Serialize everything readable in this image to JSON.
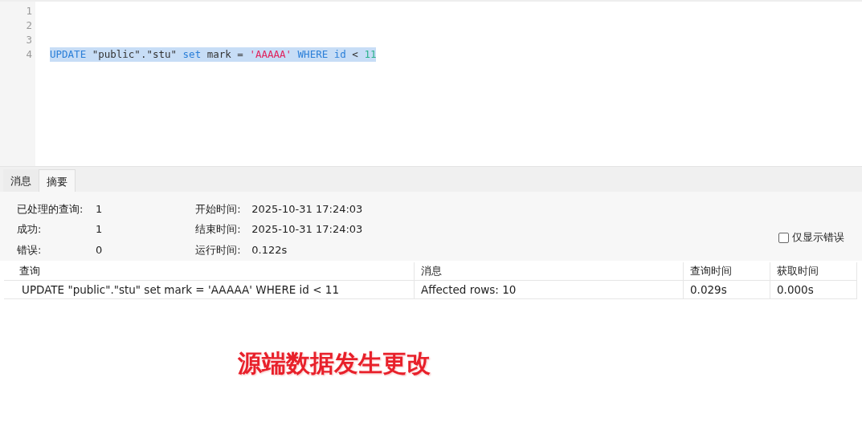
{
  "editor": {
    "lines": [
      {
        "number": "1"
      },
      {
        "number": "2"
      },
      {
        "number": "3"
      },
      {
        "number": "4",
        "selected": true,
        "tokens": [
          {
            "kind": "keyword",
            "text": "UPDATE"
          },
          {
            "kind": "plain",
            "text": " \"public\".\"stu\" "
          },
          {
            "kind": "keyword",
            "text": "set"
          },
          {
            "kind": "plain",
            "text": " mark = "
          },
          {
            "kind": "string",
            "text": "'AAAAA'"
          },
          {
            "kind": "keyword",
            "text": " WHERE id"
          },
          {
            "kind": "plain",
            "text": " < "
          },
          {
            "kind": "number",
            "text": "11"
          }
        ]
      }
    ]
  },
  "tabs": [
    {
      "label": "消息",
      "selected": false
    },
    {
      "label": "摘要",
      "selected": true
    }
  ],
  "summary": {
    "left": [
      {
        "label": "已处理的查询:",
        "value": "1"
      },
      {
        "label": "成功:",
        "value": "1"
      },
      {
        "label": "错误:",
        "value": "0"
      }
    ],
    "right": [
      {
        "label": "开始时间:",
        "value": "2025-10-31 17:24:03"
      },
      {
        "label": "结束时间:",
        "value": "2025-10-31 17:24:03"
      },
      {
        "label": "运行时间:",
        "value": "0.122s"
      }
    ],
    "errors_only": {
      "label": "仅显示错误",
      "checked": false
    }
  },
  "table": {
    "columns": [
      "查询",
      "消息",
      "查询时间",
      "获取时间"
    ],
    "rows": [
      [
        "UPDATE \"public\".\"stu\" set mark = 'AAAAA' WHERE id < 11",
        "Affected rows: 10",
        "0.029s",
        "0.000s"
      ]
    ]
  },
  "annotation": "源端数据发生更改"
}
